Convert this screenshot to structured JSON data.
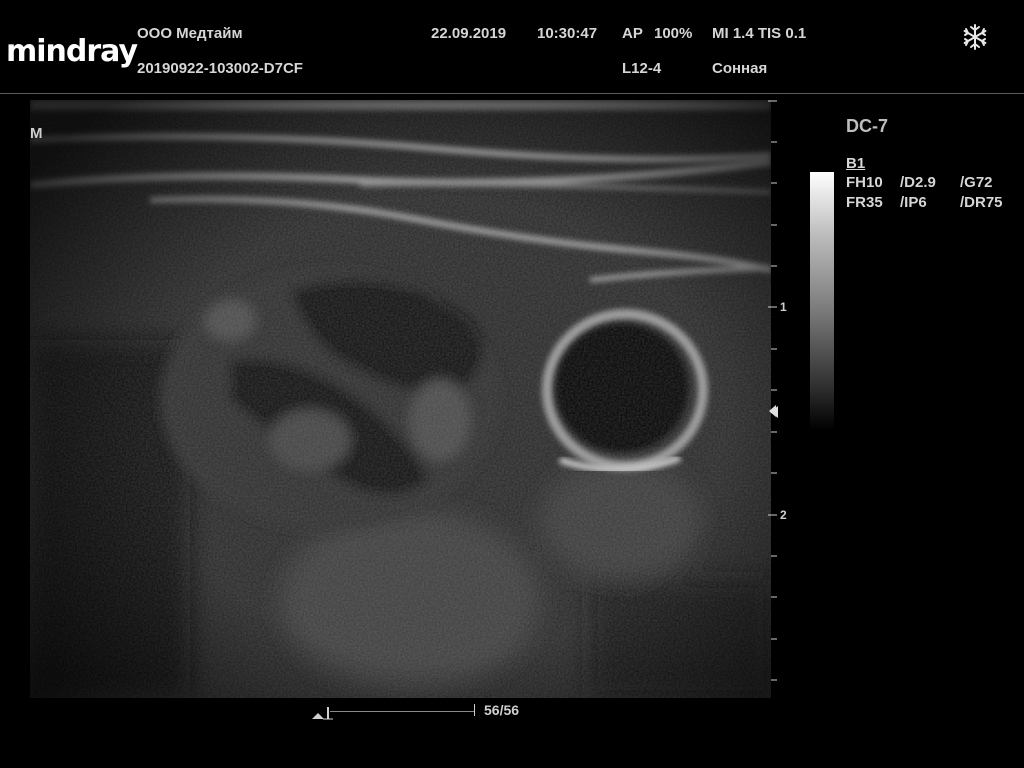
{
  "header": {
    "logo": "mindray",
    "org": "ООО Медтайм",
    "exam_id": "20190922-103002-D7CF",
    "date": "22.09.2019",
    "time": "10:30:47",
    "ap": "AP",
    "ap_value": "100%",
    "mi_tis": "MI 1.4 TIS 0.1",
    "probe": "L12-4",
    "preset": "Сонная",
    "freeze_icon": "snowflake-icon"
  },
  "image": {
    "orientation_mark": "M"
  },
  "depth_scale": {
    "labels": [
      "1",
      "2"
    ]
  },
  "params": {
    "model": "DC-7",
    "mode": "B1",
    "rows": [
      [
        "FH10",
        "/D2.9",
        "/G72"
      ],
      [
        "FR35",
        "/IP6",
        "/DR75"
      ]
    ]
  },
  "cine": {
    "frames": "56/56"
  }
}
